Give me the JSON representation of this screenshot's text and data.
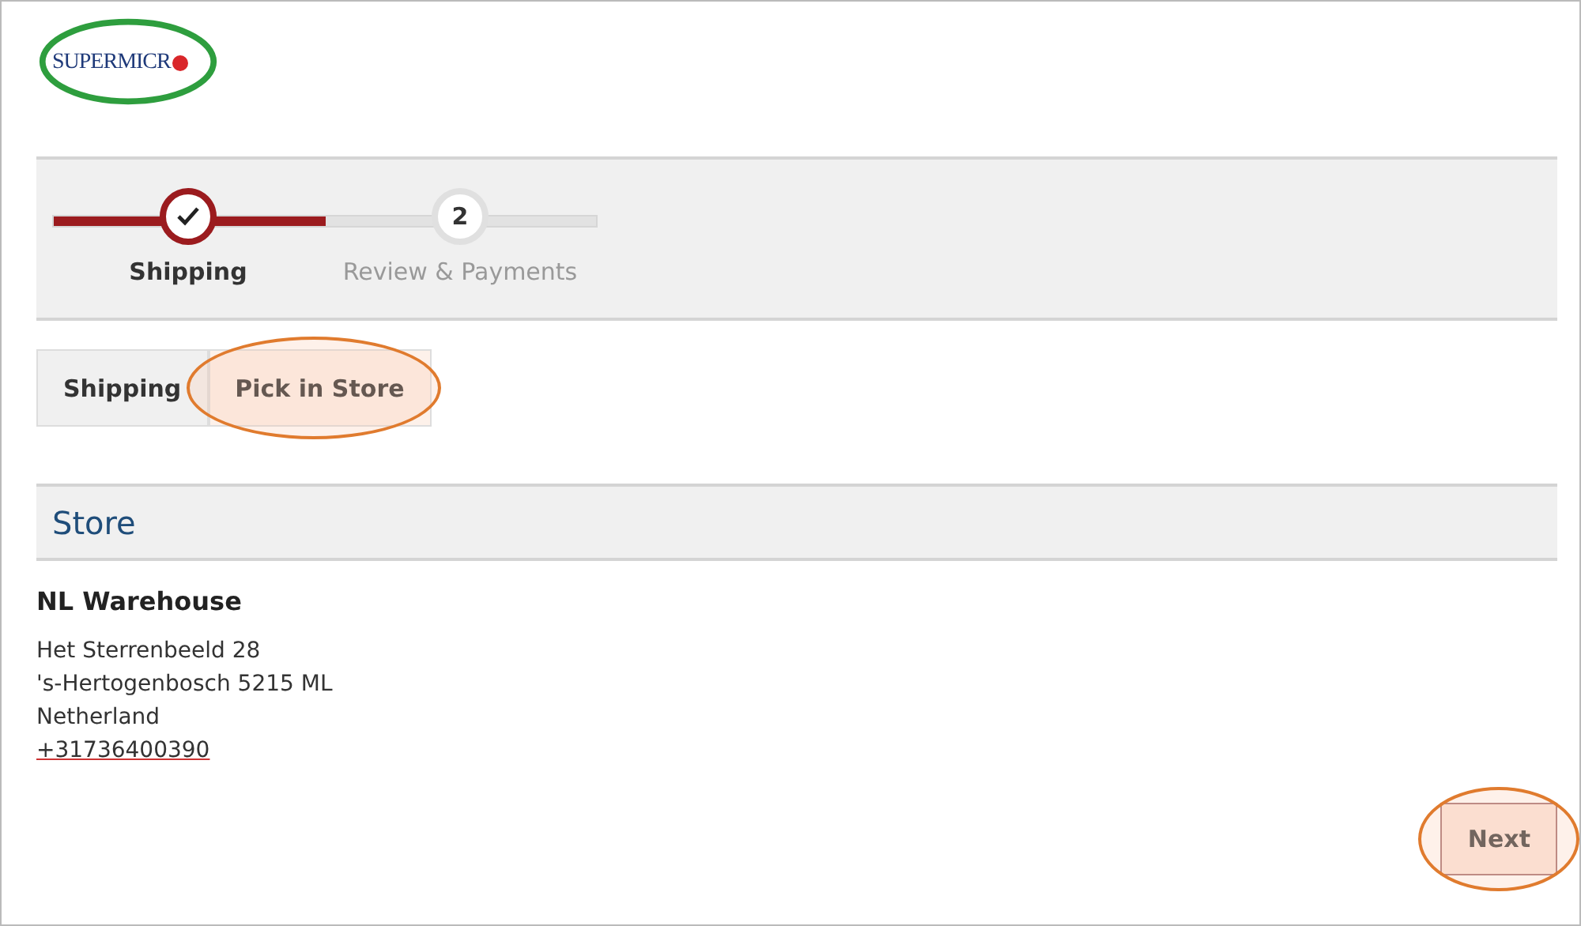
{
  "logo": {
    "text": "SUPERMICR"
  },
  "progress": {
    "level": 0.5,
    "steps": [
      {
        "label": "Shipping",
        "completed": true
      },
      {
        "label": "Review & Payments",
        "number": "2",
        "completed": false
      }
    ]
  },
  "tabs": [
    {
      "label": "Shipping",
      "selected": false,
      "highlighted": false
    },
    {
      "label": "Pick in Store",
      "selected": true,
      "highlighted": true
    }
  ],
  "section": {
    "title": "Store"
  },
  "store": {
    "name": "NL Warehouse",
    "address": [
      "Het Sterrenbeeld 28",
      "'s-Hertogenbosch 5215 ML",
      "Netherland"
    ],
    "phone": "+31736400390"
  },
  "next_button": {
    "label": "Next",
    "highlighted": true
  }
}
